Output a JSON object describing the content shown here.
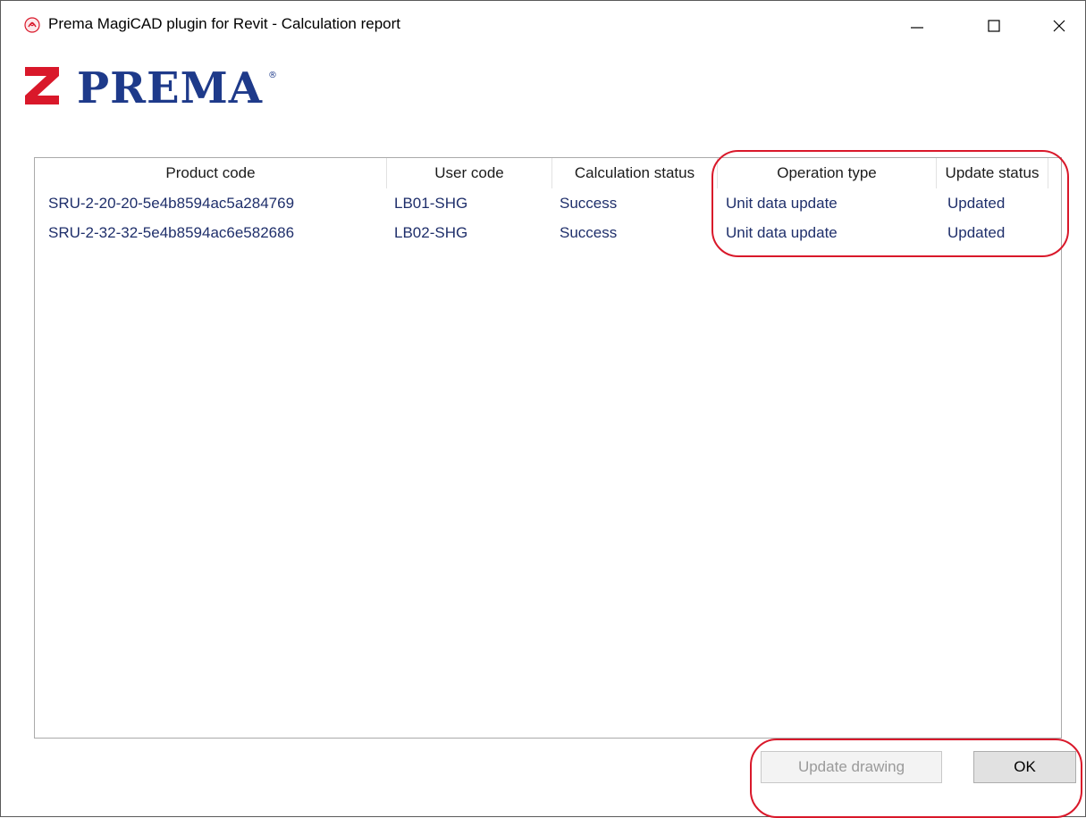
{
  "window": {
    "title": "Prema MagiCAD plugin for Revit - Calculation report",
    "icon": "prema-app-icon",
    "controls": [
      "minimize-icon",
      "maximize-icon",
      "close-icon"
    ]
  },
  "logo": {
    "text": "PREMA",
    "registered_mark": "®",
    "brand_color": "#d9182a",
    "text_color": "#1e3a8a"
  },
  "table": {
    "columns": [
      "Product code",
      "User code",
      "Calculation status",
      "Operation type",
      "Update status"
    ],
    "rows": [
      [
        "SRU-2-20-20-5e4b8594ac5a284769",
        "LB01-SHG",
        "Success",
        "Unit data update",
        "Updated"
      ],
      [
        "SRU-2-32-32-5e4b8594ac6e582686",
        "LB02-SHG",
        "Success",
        "Unit data update",
        "Updated"
      ]
    ]
  },
  "buttons": {
    "update_drawing": "Update drawing",
    "ok": "OK"
  },
  "colors": {
    "annotation": "#d9182a",
    "cell_text": "#1f2f6b"
  }
}
